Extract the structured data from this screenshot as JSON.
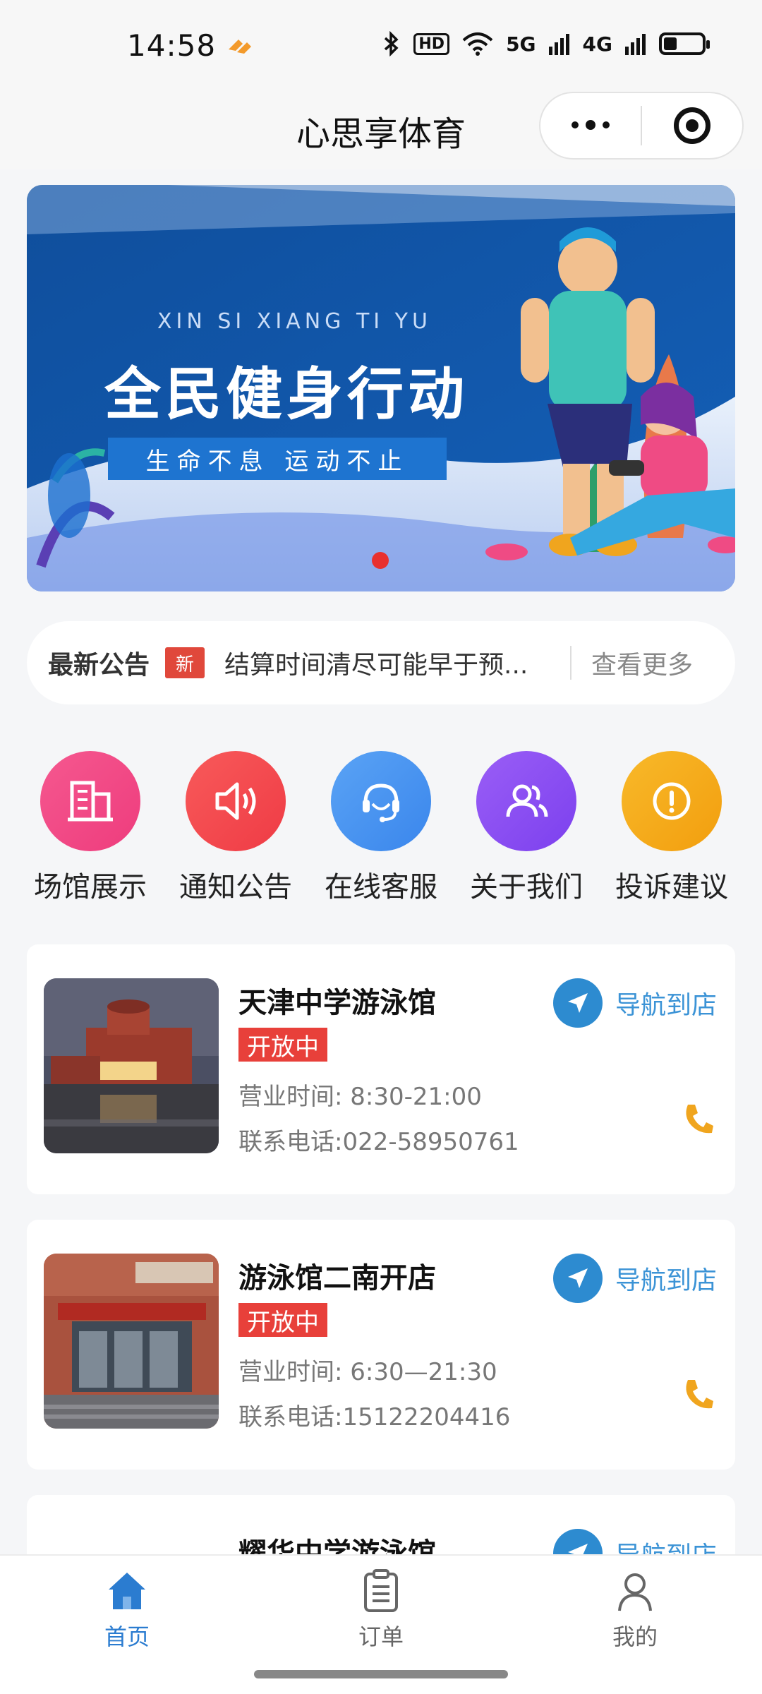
{
  "status_bar": {
    "time": "14:58",
    "network_1": "5G",
    "network_2": "4G",
    "hd": "HD"
  },
  "nav": {
    "title": "心思享体育"
  },
  "banner": {
    "subtitle": "XIN SI XIANG TI YU",
    "title": "全民健身行动",
    "slogan": "生命不息 运动不止"
  },
  "notice": {
    "label": "最新公告",
    "badge": "新",
    "text": "结算时间清尽可能早于预...",
    "more": "查看更多"
  },
  "quick_menu": [
    {
      "label": "场馆展示",
      "icon": "building-icon",
      "color": "#f0468a"
    },
    {
      "label": "通知公告",
      "icon": "speaker-icon",
      "color": "#f2464f"
    },
    {
      "label": "在线客服",
      "icon": "headset-icon",
      "color": "#3f8ff0"
    },
    {
      "label": "关于我们",
      "icon": "users-icon",
      "color": "#8a4ff2"
    },
    {
      "label": "投诉建议",
      "icon": "exclamation-icon",
      "color": "#f5a917"
    }
  ],
  "venues": [
    {
      "name": "天津中学游泳馆",
      "status": "开放中",
      "hours": "营业时间: 8:30-21:00",
      "phone": "联系电话:022-58950761",
      "nav_label": "导航到店"
    },
    {
      "name": "游泳馆二南开店",
      "status": "开放中",
      "hours": "营业时间: 6:30—21:30",
      "phone": "联系电话:15122204416",
      "nav_label": "导航到店"
    },
    {
      "name": "耀华中学游泳馆",
      "nav_label": "导航到店"
    }
  ],
  "tabbar": [
    {
      "label": "首页",
      "icon": "home-icon",
      "active": true
    },
    {
      "label": "订单",
      "icon": "clipboard-icon",
      "active": false
    },
    {
      "label": "我的",
      "icon": "user-icon",
      "active": false
    }
  ],
  "colors": {
    "accent": "#2b7cd0",
    "status_open": "#e8403a",
    "phone_icon": "#f0a51e"
  }
}
